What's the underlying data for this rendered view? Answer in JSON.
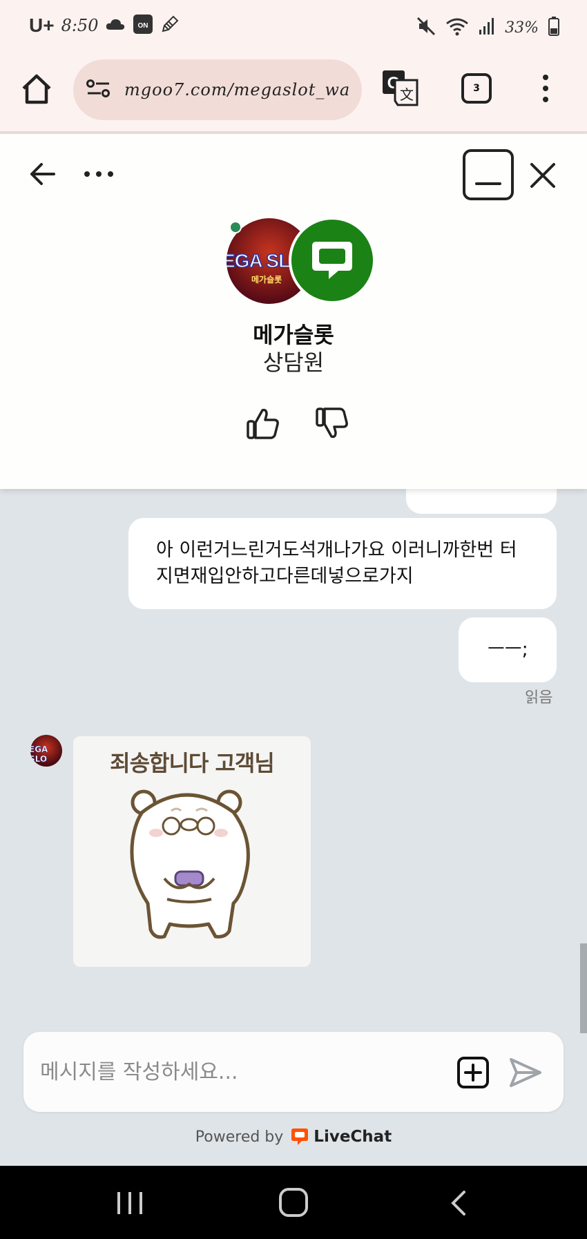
{
  "status_bar": {
    "carrier": "U+",
    "time": "8:50",
    "battery": "33%"
  },
  "browser": {
    "url": "mgoo7.com/megaslot_wa",
    "tab_count": "3"
  },
  "chat_header": {
    "agent_name": "메가슬롯",
    "agent_role": "상담원",
    "avatar_logo": "EGA SL",
    "avatar_logo_sub": "메가슬롯"
  },
  "messages": {
    "msg1": "아 이런거느린거도석개나가요 이러니까한번 터지면재입안하고다른데넣으로가지",
    "msg2": "ㅡㅡ;",
    "read_status": "읽음",
    "sticker_text": "죄송합니다 고객님",
    "small_avatar_logo": "EGA SLO"
  },
  "composer": {
    "placeholder": "메시지를 작성하세요..."
  },
  "footer": {
    "powered_by": "Powered by",
    "brand": "LiveChat"
  },
  "colors": {
    "livechat_green": "#1b8215",
    "livechat_orange": "#ff5100",
    "online_dot": "#2b8b57"
  }
}
